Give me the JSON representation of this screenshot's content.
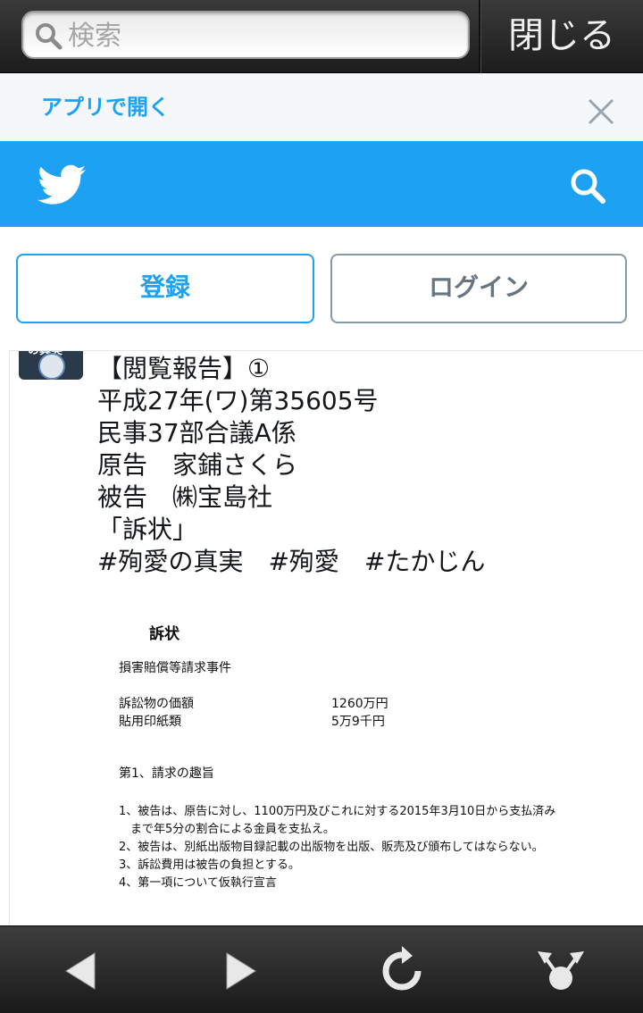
{
  "browser": {
    "search_placeholder": "検索",
    "close_label": "閉じる"
  },
  "app_banner": {
    "open_in_app": "アプリで開く"
  },
  "colors": {
    "twitter_blue": "#1da1f2",
    "border_gray": "#8899a6"
  },
  "auth": {
    "signup": "登録",
    "login": "ログイン"
  },
  "tweet": {
    "avatar_text": "の真実",
    "lines": [
      "【閲覧報告】①",
      "平成27年(ワ)第35605号",
      "民事37部合議A係",
      "原告　家鋪さくら",
      "被告　㈱宝島社",
      "「訴状」",
      "#殉愛の真実　#殉愛　#たかじん"
    ]
  },
  "document": {
    "title": "訴状",
    "case": "損害賠償等請求事件",
    "rows": [
      {
        "label": "訴訟物の価額",
        "value": "1260万円"
      },
      {
        "label": "貼用印紙類",
        "value": "5万9千円"
      }
    ],
    "section": "第1、請求の趣旨",
    "items": [
      "1、被告は、原告に対し、1100万円及びこれに対する2015年3月10日から支払済み",
      "　まで年5分の割合による金員を支払え。",
      "2、被告は、別紙出版物目録記載の出版物を出版、販売及び頒布してはならない。",
      "3、訴訟費用は被告の負担とする。",
      "4、第一項について仮執行宣言"
    ]
  },
  "bottom_nav": {
    "icons": [
      "back-icon",
      "forward-icon",
      "reload-icon",
      "share-icon"
    ]
  }
}
